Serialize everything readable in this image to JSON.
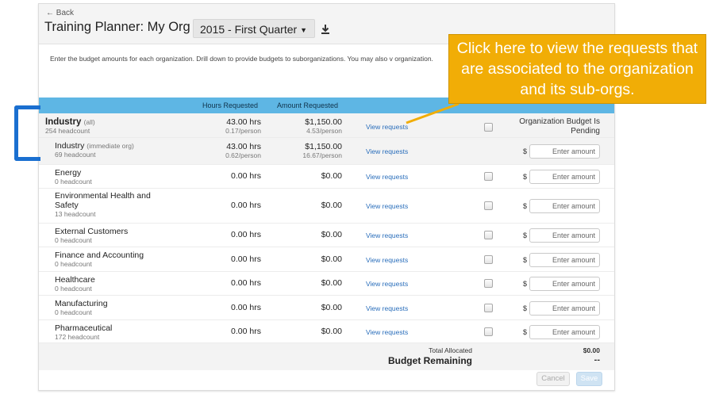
{
  "header": {
    "back_label": "← Back",
    "title": "Training Planner: My Org",
    "period": "2015 - First Quarter",
    "download_icon": "download-icon"
  },
  "instructions": "Enter the budget amounts for each organization. Drill down to provide budgets to suborganizations. You may also v organization.",
  "table": {
    "columns": [
      "Hours Requested",
      "Amount Requested"
    ],
    "top_org": {
      "name": "Industry",
      "tag": "(all)",
      "headcount": "254 headcount",
      "hours": "43.00 hrs",
      "hours_per": "0.17/person",
      "amount": "$1,150.00",
      "amount_per": "4.53/person",
      "link": "View requests",
      "status": "Organization Budget Is Pending"
    },
    "rows": [
      {
        "name": "Industry",
        "tag": "(immediate org)",
        "headcount": "69 headcount",
        "hours": "43.00 hrs",
        "hours_per": "0.62/person",
        "amount": "$1,150.00",
        "amount_per": "16.67/person",
        "link": "View requests"
      },
      {
        "name": "Energy",
        "headcount": "0 headcount",
        "hours": "0.00 hrs",
        "amount": "$0.00",
        "link": "View requests"
      },
      {
        "name": "Environmental Health and Safety",
        "headcount": "13 headcount",
        "hours": "0.00 hrs",
        "amount": "$0.00",
        "link": "View requests"
      },
      {
        "name": "External Customers",
        "headcount": "0 headcount",
        "hours": "0.00 hrs",
        "amount": "$0.00",
        "link": "View requests"
      },
      {
        "name": "Finance and Accounting",
        "headcount": "0 headcount",
        "hours": "0.00 hrs",
        "amount": "$0.00",
        "link": "View requests"
      },
      {
        "name": "Healthcare",
        "headcount": "0 headcount",
        "hours": "0.00 hrs",
        "amount": "$0.00",
        "link": "View requests"
      },
      {
        "name": "Manufacturing",
        "headcount": "0 headcount",
        "hours": "0.00 hrs",
        "amount": "$0.00",
        "link": "View requests"
      },
      {
        "name": "Pharmaceutical",
        "headcount": "172 headcount",
        "hours": "0.00 hrs",
        "amount": "$0.00",
        "link": "View requests"
      }
    ],
    "currency_symbol": "$",
    "amount_placeholder": "Enter amount"
  },
  "footer": {
    "total_label": "Total Allocated",
    "total_value": "$0.00",
    "remaining_label": "Budget Remaining",
    "remaining_value": "--",
    "cancel_label": "Cancel",
    "save_label": "Save"
  },
  "callout": {
    "text": "Click here to view the requests that are associated to the organization and its sub-orgs."
  },
  "colors": {
    "table_header": "#5eb6e4",
    "callout": "#f1ad06",
    "bracket": "#1a6fd0",
    "link": "#2a6ebb"
  }
}
